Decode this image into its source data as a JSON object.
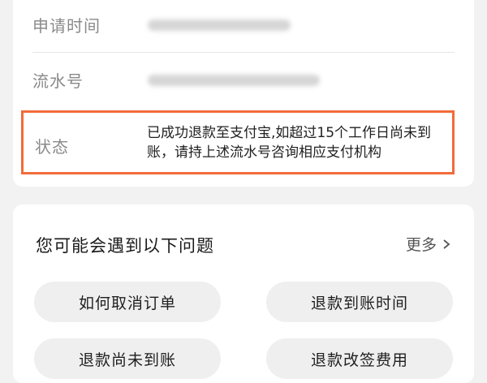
{
  "details": {
    "apply_time_label": "申请时间",
    "serial_label": "流水号",
    "status_label": "状态",
    "status_text": "已成功退款至支付宝,如超过15个工作日尚未到账，请持上述流水号咨询相应支付机构"
  },
  "questions": {
    "title": "您可能会遇到以下问题",
    "more_label": "更多",
    "items": [
      {
        "label": "如何取消订单"
      },
      {
        "label": "退款到账时间"
      },
      {
        "label": "退款尚未到账"
      },
      {
        "label": "退款改签费用"
      }
    ]
  },
  "colors": {
    "highlight_border": "#f26b3a",
    "background": "#f2f2f2",
    "card": "#ffffff",
    "pill": "#efefef"
  },
  "icons": {
    "more_icon": "chevron-right-icon"
  }
}
